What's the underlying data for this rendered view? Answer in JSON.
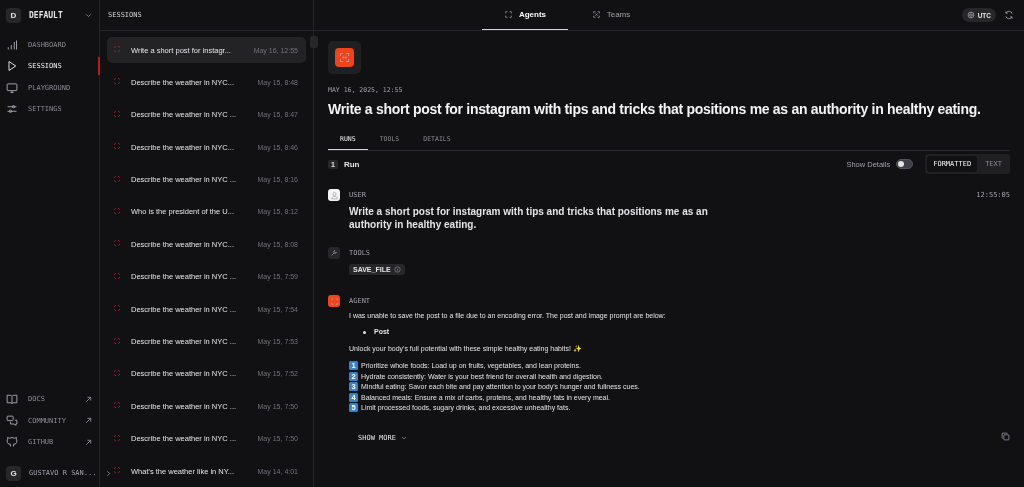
{
  "workspace": {
    "initial": "D",
    "name": "DEFAULT"
  },
  "nav": [
    {
      "label": "DASHBOARD",
      "kind": "chart",
      "selected": false
    },
    {
      "label": "SESSIONS",
      "kind": "play",
      "selected": true
    },
    {
      "label": "PLAYGROUND",
      "kind": "monitor",
      "selected": false
    },
    {
      "label": "SETTINGS",
      "kind": "sliders",
      "selected": false
    }
  ],
  "links": [
    {
      "label": "DOCS",
      "kind": "book"
    },
    {
      "label": "COMMUNITY",
      "kind": "chat"
    },
    {
      "label": "GITHUB",
      "kind": "github"
    }
  ],
  "user": {
    "initial": "G",
    "name": "GUSTAVO R SAN..."
  },
  "sessions": {
    "title": "SESSIONS",
    "items": [
      {
        "title": "Write a short post for instagr...",
        "time": "May 16, 12:55",
        "selected": true
      },
      {
        "title": "Describe the weather in NYC...",
        "time": "May 15, 8:48",
        "selected": false
      },
      {
        "title": "Describe the weather in NYC ...",
        "time": "May 15, 8:47",
        "selected": false
      },
      {
        "title": "Describe the weather in NYC...",
        "time": "May 15, 8:46",
        "selected": false
      },
      {
        "title": "Describe the weather in NYC ...",
        "time": "May 15, 8:16",
        "selected": false
      },
      {
        "title": "Who is the president of the U...",
        "time": "May 15, 8:12",
        "selected": false
      },
      {
        "title": "Describe the weather in NYC...",
        "time": "May 15, 8:08",
        "selected": false
      },
      {
        "title": "Describe the weather in NYC ...",
        "time": "May 15, 7:59",
        "selected": false
      },
      {
        "title": "Describe the weather in NYC ...",
        "time": "May 15, 7:54",
        "selected": false
      },
      {
        "title": "Describe the weather in NYC ...",
        "time": "May 15, 7:53",
        "selected": false
      },
      {
        "title": "Describe the weather in NYC ...",
        "time": "May 15, 7:52",
        "selected": false
      },
      {
        "title": "Describe the weather in NYC ...",
        "time": "May 15, 7:50",
        "selected": false
      },
      {
        "title": "Describe the weather in NYC ...",
        "time": "May 15, 7:50",
        "selected": false
      },
      {
        "title": "What's the weather like in NY...",
        "time": "May 14, 4:01",
        "selected": false
      }
    ]
  },
  "top_tabs": [
    {
      "label": "Agents",
      "kind": "agent",
      "selected": true
    },
    {
      "label": "Teams",
      "kind": "team",
      "selected": false
    }
  ],
  "timezone": "UTC",
  "run": {
    "date": "MAY 16, 2025, 12:55",
    "title": "Write a short post for instagram with tips and tricks that positions me as an authority in healthy eating.",
    "tabs": [
      {
        "label": "RUNS",
        "selected": true
      },
      {
        "label": "TOOLS",
        "selected": false
      },
      {
        "label": "DETAILS",
        "selected": false
      }
    ],
    "count": "1",
    "label": "Run",
    "show_details": {
      "label": "Show Details",
      "on": false
    },
    "view_modes": [
      {
        "label": "FORMATTED",
        "selected": true
      },
      {
        "label": "TEXT",
        "selected": false
      }
    ]
  },
  "user_message": {
    "role": "USER",
    "time": "12:55:05",
    "text": "Write a short post for instagram with tips and tricks that positions me as an authority in healthy eating."
  },
  "tools_message": {
    "role": "TOOLS",
    "tools": [
      "SAVE_FILE"
    ]
  },
  "agent_message": {
    "role": "AGENT",
    "intro": "I was unable to save the post to a file due to an encoding error. The post and image prompt are below:",
    "bullets": [
      "Post"
    ],
    "lead": "Unlock your body's full potential with these simple healthy eating habits! ✨",
    "steps": [
      {
        "number": "1",
        "text": "Prioritize whole foods: Load up on fruits, vegetables, and lean proteins."
      },
      {
        "number": "2",
        "text": "Hydrate consistently: Water is your best friend for overall health and digestion."
      },
      {
        "number": "3",
        "text": "Mindful eating: Savor each bite and pay attention to your body's hunger and fullness cues."
      },
      {
        "number": "4",
        "text": "Balanced meals: Ensure a mix of carbs, proteins, and healthy fats in every meal."
      },
      {
        "number": "5",
        "text": "Limit processed foods, sugary drinks, and excessive unhealthy fats."
      }
    ],
    "show_more": "SHOW MORE"
  }
}
